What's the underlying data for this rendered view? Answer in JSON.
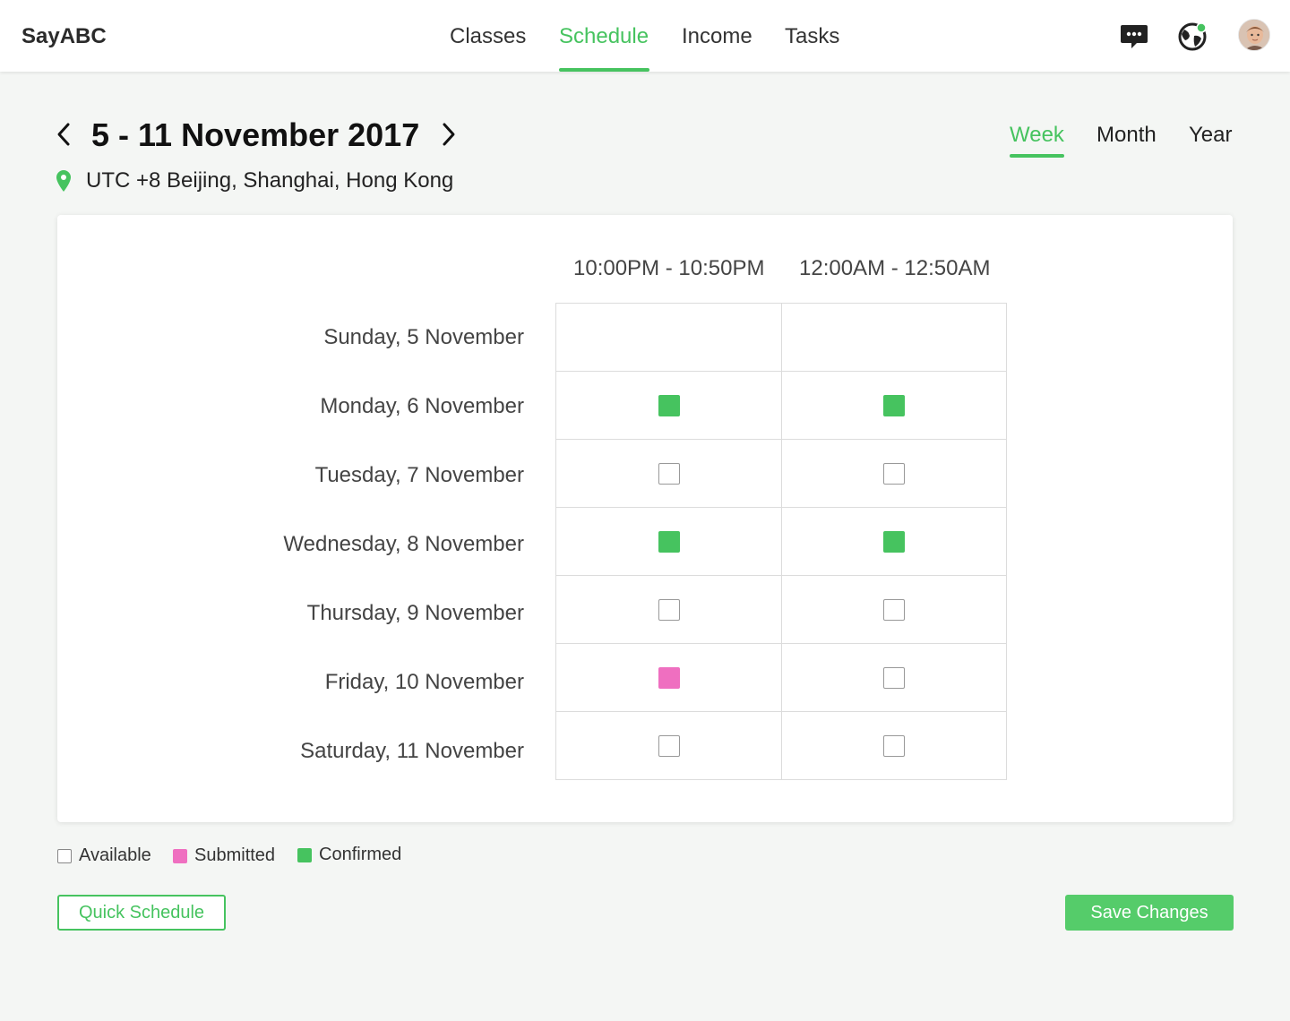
{
  "app": {
    "brand": "SayABC"
  },
  "nav": {
    "items": [
      {
        "label": "Classes",
        "active": false
      },
      {
        "label": "Schedule",
        "active": true
      },
      {
        "label": "Income",
        "active": false
      },
      {
        "label": "Tasks",
        "active": false
      }
    ]
  },
  "topbar_icons": [
    "chat-icon",
    "globe-icon",
    "avatar"
  ],
  "header": {
    "date_range": "5 - 11 November 2017",
    "timezone": "UTC +8 Beijing, Shanghai, Hong Kong",
    "views": [
      {
        "label": "Week",
        "active": true
      },
      {
        "label": "Month",
        "active": false
      },
      {
        "label": "Year",
        "active": false
      }
    ]
  },
  "schedule": {
    "columns": [
      "10:00PM - 10:50PM",
      "12:00AM - 12:50AM"
    ],
    "rows": [
      {
        "label": "Sunday, 5 November",
        "slots": [
          "none",
          "none"
        ]
      },
      {
        "label": "Monday, 6 November",
        "slots": [
          "confirmed",
          "confirmed"
        ]
      },
      {
        "label": "Tuesday, 7 November",
        "slots": [
          "available",
          "available"
        ]
      },
      {
        "label": "Wednesday, 8 November",
        "slots": [
          "confirmed",
          "confirmed"
        ]
      },
      {
        "label": "Thursday, 9 November",
        "slots": [
          "available",
          "available"
        ]
      },
      {
        "label": "Friday, 10 November",
        "slots": [
          "submitted",
          "available"
        ]
      },
      {
        "label": "Saturday, 11 November",
        "slots": [
          "available",
          "available"
        ]
      }
    ]
  },
  "legend": {
    "available": "Available",
    "submitted": "Submitted",
    "confirmed": "Confirmed"
  },
  "actions": {
    "quick_schedule": "Quick Schedule",
    "save_changes": "Save Changes"
  },
  "colors": {
    "accent": "#46c35f",
    "submitted": "#ef6fc0",
    "confirmed": "#46c35f"
  }
}
